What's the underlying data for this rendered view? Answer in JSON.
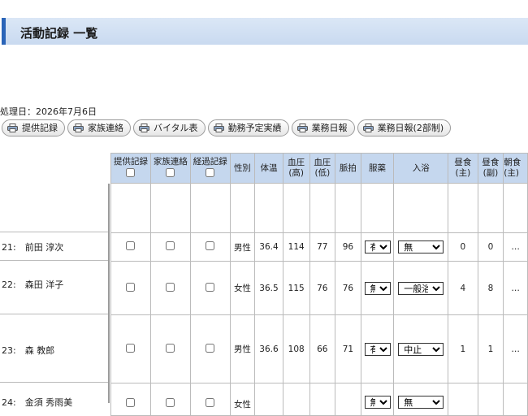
{
  "page": {
    "title": "活動記録 一覧",
    "process_date": "処理日：2026年7月6日"
  },
  "buttons": [
    {
      "label": "提供記録"
    },
    {
      "label": "家族連絡"
    },
    {
      "label": "バイタル表"
    },
    {
      "label": "勤務予定実績"
    },
    {
      "label": "業務日報"
    },
    {
      "label": "業務日報(2部制)"
    }
  ],
  "headers": {
    "teikyo": "提供記録",
    "kazoku": "家族連絡",
    "keika": "経過記録",
    "sex": "性別",
    "temp": "体温",
    "bp_high": "血圧\n(高)",
    "bp_low": "血圧\n(低)",
    "pulse": "脈拍",
    "med": "服薬",
    "bath": "入浴",
    "lunch_main": "昼食\n(主)",
    "lunch_side": "昼食\n(副)",
    "breakfast_main": "朝食\n(主)"
  },
  "rows": [
    {
      "name": "21:　前田 淳次",
      "sex": "男性",
      "temp": "36.4",
      "bp_high": "114",
      "bp_low": "77",
      "pulse": "96",
      "med": "有",
      "bath": "無",
      "lunch_main": "0",
      "lunch_side": "0",
      "more": "…"
    },
    {
      "name": "22:　森田 洋子",
      "sex": "女性",
      "temp": "36.5",
      "bp_high": "115",
      "bp_low": "76",
      "pulse": "76",
      "med": "無",
      "bath": "一般浴",
      "lunch_main": "4",
      "lunch_side": "8",
      "more": "…"
    },
    {
      "name": "23:　森 教郎",
      "sex": "男性",
      "temp": "36.6",
      "bp_high": "108",
      "bp_low": "66",
      "pulse": "71",
      "med": "有",
      "bath": "中止",
      "lunch_main": "1",
      "lunch_side": "1",
      "more": "…"
    },
    {
      "name": "24:　金須 秀雨美",
      "sex": "女性",
      "temp": "",
      "bp_high": "",
      "bp_low": "",
      "pulse": "",
      "med": "無",
      "bath": "無",
      "lunch_main": "",
      "lunch_side": "",
      "more": ""
    }
  ]
}
